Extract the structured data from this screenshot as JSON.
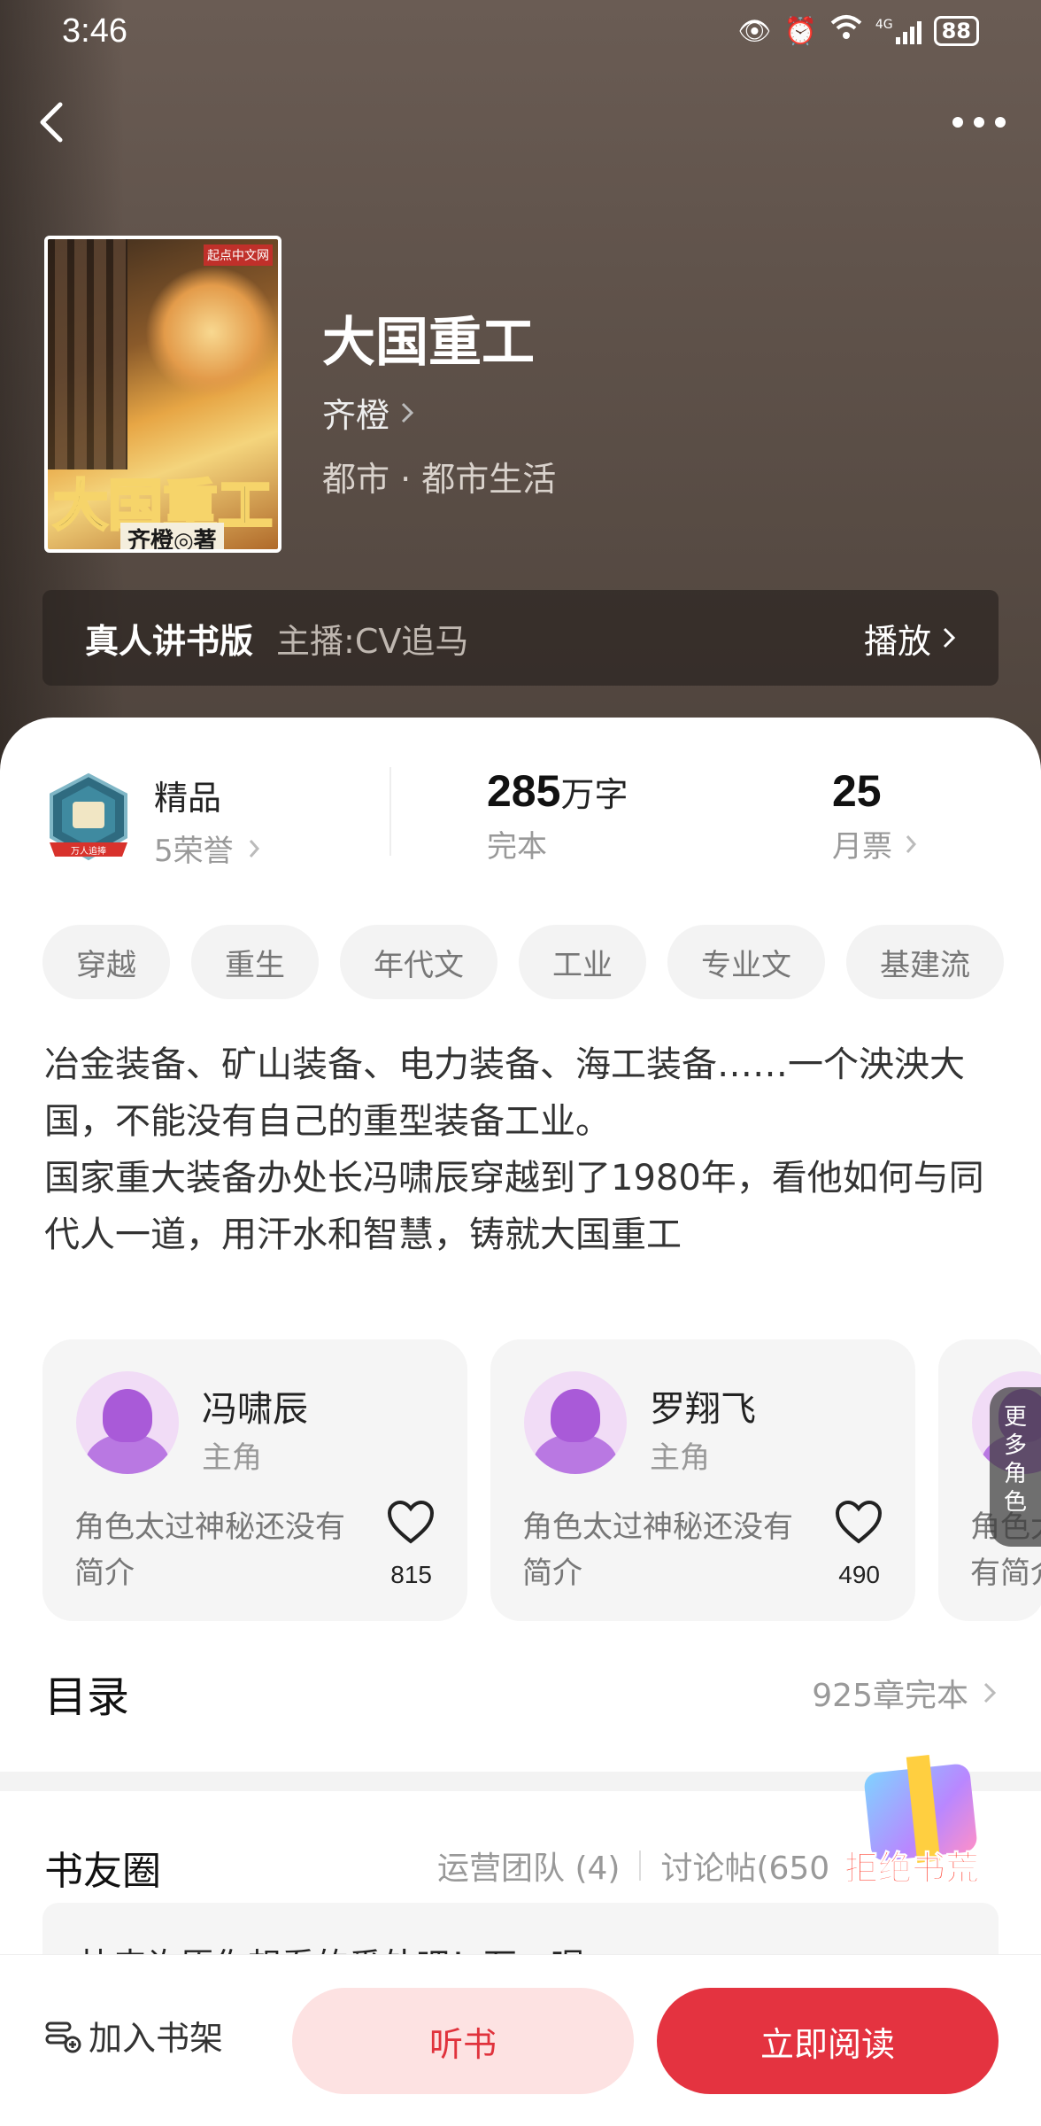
{
  "status_bar": {
    "time": "3:46",
    "signal": "4G",
    "battery": "88"
  },
  "book": {
    "title": "大国重工",
    "author": "齐橙",
    "genre": "都市 · 都市生活",
    "cover_title": "大国重工",
    "cover_author": "齐橙◎著",
    "cover_badge": "起点中文网"
  },
  "audio": {
    "label": "真人讲书版",
    "host": "主播:CV追马",
    "play_label": "播放"
  },
  "stats": {
    "honor_label": "精品",
    "honor_sub": "5荣誉",
    "medal_text": "万人追捧",
    "words_value": "285",
    "words_unit": "万字",
    "words_status": "完本",
    "tickets_value": "25",
    "tickets_label": "月票"
  },
  "tags": [
    "穿越",
    "重生",
    "年代文",
    "工业",
    "专业文",
    "基建流"
  ],
  "description": [
    "冶金装备、矿山装备、电力装备、海工装备……一个泱泱大国，不能没有自己的重型装备工业。",
    "国家重大装备办处长冯啸辰穿越到了1980年，看他如何与同代人一道，用汗水和智慧，铸就大国重工"
  ],
  "roles": [
    {
      "name": "冯啸辰",
      "type": "主角",
      "desc": "角色太过神秘还没有简介",
      "likes": "815"
    },
    {
      "name": "罗翔飞",
      "type": "主角",
      "desc": "角色太过神秘还没有简介",
      "likes": "490"
    },
    {
      "name": "",
      "type": "",
      "desc": "角色太过神秘还没有简介",
      "likes": ""
    }
  ],
  "more_roles_label": "更多角色",
  "toc": {
    "heading": "目录",
    "summary": "925章完本"
  },
  "circle": {
    "heading": "书友圈",
    "team": "运营团队 (4)",
    "posts": "讨论帖(650",
    "preview": "快来许愿你想看的番外吧！万一呢……"
  },
  "promo": {
    "text": "拒绝书荒"
  },
  "actions": {
    "shelf": "加入书架",
    "listen": "听书",
    "read": "立即阅读"
  },
  "colors": {
    "accent": "#e43340",
    "listen_bg": "#fde2e2",
    "hero_bg": "#5f524a"
  }
}
